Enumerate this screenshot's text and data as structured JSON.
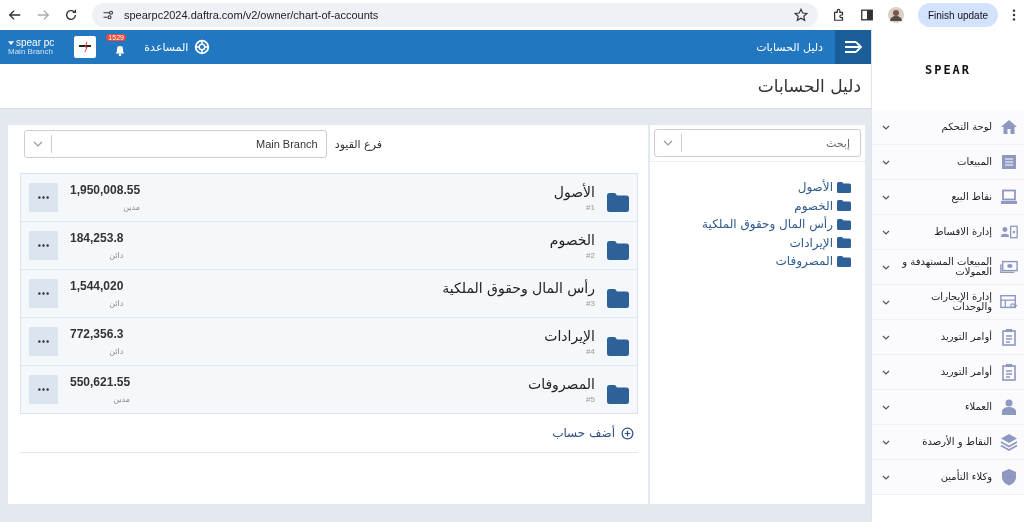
{
  "browser": {
    "url": "spearpc2024.daftra.com/v2/owner/chart-of-accounts",
    "update_button": "Finish update"
  },
  "header": {
    "title": "دليل الحسابات",
    "help": "المساعدة",
    "notifications": "1529",
    "user": "spear pc",
    "branch": "Main Branch"
  },
  "logo": "SPEAR",
  "page_title": "دليل الحسابات",
  "branch_filter": {
    "label": "فرع القيود",
    "value": "Main Branch"
  },
  "accounts": [
    {
      "name": "الأصول",
      "number": "#1",
      "balance": "1,950,008.55",
      "type": "مدين"
    },
    {
      "name": "الخصوم",
      "number": "#2",
      "balance": "184,253.8",
      "type": "دائن"
    },
    {
      "name": "رأس المال وحقوق الملكية",
      "number": "#3",
      "balance": "1,544,020",
      "type": "دائن"
    },
    {
      "name": "الإيرادات",
      "number": "#4",
      "balance": "772,356.3",
      "type": "دائن"
    },
    {
      "name": "المصروفات",
      "number": "#5",
      "balance": "550,621.55",
      "type": "مدين"
    }
  ],
  "add_account": "أضف حساب",
  "tree": {
    "search_placeholder": "إبحث",
    "items": [
      "الأصول",
      "الخصوم",
      "رأس المال وحقوق الملكية",
      "الإيرادات",
      "المصروفات"
    ]
  },
  "sidebar": {
    "items": [
      {
        "label": "لوحة التحكم",
        "kind": "home"
      },
      {
        "label": "المبيعات",
        "kind": "list"
      },
      {
        "label": "نقاط البيع",
        "kind": "laptop"
      },
      {
        "label": "إدارة الاقساط",
        "kind": "card"
      },
      {
        "label": "المبيعات المستهدفة و العمولات",
        "kind": "cash"
      },
      {
        "label": "إدارة الإيجارات والوحدات",
        "kind": "store"
      },
      {
        "label": "أوامر التوريد",
        "kind": "clipboard"
      },
      {
        "label": "أوامر التوريد",
        "kind": "clipboard"
      },
      {
        "label": "العملاء",
        "kind": "person"
      },
      {
        "label": "النقاط و الأرصدة",
        "kind": "layers"
      },
      {
        "label": "وكلاء التأمين",
        "kind": "shield"
      }
    ]
  }
}
